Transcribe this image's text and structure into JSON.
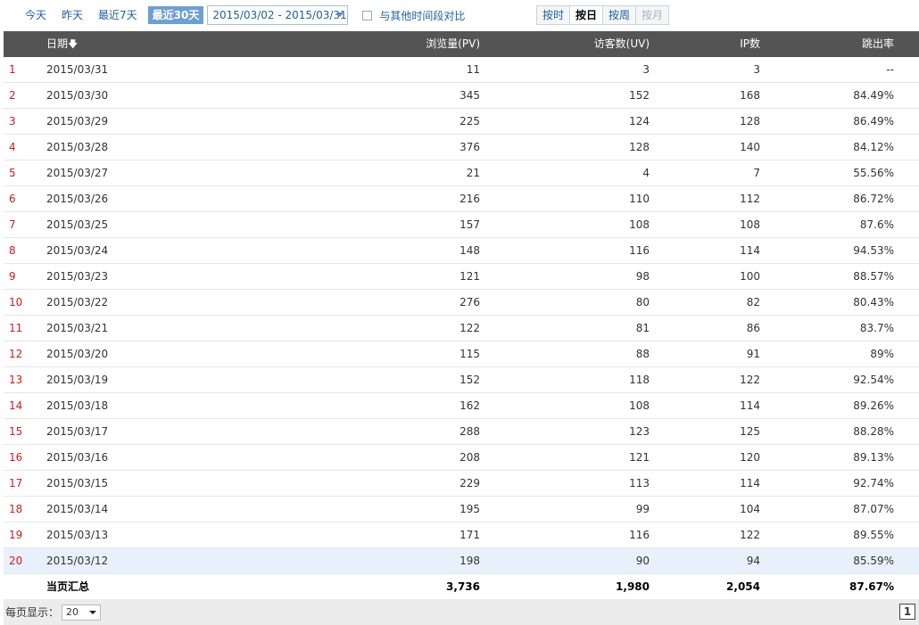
{
  "toolbar": {
    "quick": [
      "今天",
      "昨天",
      "最近7天",
      "最近30天"
    ],
    "active_index": 3,
    "date_range": "2015/03/02 - 2015/03/31",
    "compare_label": "与其他时间段对比",
    "granularity": [
      "按时",
      "按日",
      "按周",
      "按月"
    ],
    "granularity_active": "按日",
    "granularity_disabled": "按月"
  },
  "table": {
    "headers": {
      "date": "日期",
      "date_sort_icon": "arrow-down-icon",
      "pv": "浏览量(PV)",
      "uv": "访客数(UV)",
      "ip": "IP数",
      "bounce": "跳出率"
    },
    "rows": [
      {
        "idx": "1",
        "date": "2015/03/31",
        "pv": "11",
        "uv": "3",
        "ip": "3",
        "bounce": "--"
      },
      {
        "idx": "2",
        "date": "2015/03/30",
        "pv": "345",
        "uv": "152",
        "ip": "168",
        "bounce": "84.49%"
      },
      {
        "idx": "3",
        "date": "2015/03/29",
        "pv": "225",
        "uv": "124",
        "ip": "128",
        "bounce": "86.49%"
      },
      {
        "idx": "4",
        "date": "2015/03/28",
        "pv": "376",
        "uv": "128",
        "ip": "140",
        "bounce": "84.12%"
      },
      {
        "idx": "5",
        "date": "2015/03/27",
        "pv": "21",
        "uv": "4",
        "ip": "7",
        "bounce": "55.56%"
      },
      {
        "idx": "6",
        "date": "2015/03/26",
        "pv": "216",
        "uv": "110",
        "ip": "112",
        "bounce": "86.72%"
      },
      {
        "idx": "7",
        "date": "2015/03/25",
        "pv": "157",
        "uv": "108",
        "ip": "108",
        "bounce": "87.6%"
      },
      {
        "idx": "8",
        "date": "2015/03/24",
        "pv": "148",
        "uv": "116",
        "ip": "114",
        "bounce": "94.53%"
      },
      {
        "idx": "9",
        "date": "2015/03/23",
        "pv": "121",
        "uv": "98",
        "ip": "100",
        "bounce": "88.57%"
      },
      {
        "idx": "10",
        "date": "2015/03/22",
        "pv": "276",
        "uv": "80",
        "ip": "82",
        "bounce": "80.43%"
      },
      {
        "idx": "11",
        "date": "2015/03/21",
        "pv": "122",
        "uv": "81",
        "ip": "86",
        "bounce": "83.7%"
      },
      {
        "idx": "12",
        "date": "2015/03/20",
        "pv": "115",
        "uv": "88",
        "ip": "91",
        "bounce": "89%"
      },
      {
        "idx": "13",
        "date": "2015/03/19",
        "pv": "152",
        "uv": "118",
        "ip": "122",
        "bounce": "92.54%"
      },
      {
        "idx": "14",
        "date": "2015/03/18",
        "pv": "162",
        "uv": "108",
        "ip": "114",
        "bounce": "89.26%"
      },
      {
        "idx": "15",
        "date": "2015/03/17",
        "pv": "288",
        "uv": "123",
        "ip": "125",
        "bounce": "88.28%"
      },
      {
        "idx": "16",
        "date": "2015/03/16",
        "pv": "208",
        "uv": "121",
        "ip": "120",
        "bounce": "89.13%"
      },
      {
        "idx": "17",
        "date": "2015/03/15",
        "pv": "229",
        "uv": "113",
        "ip": "114",
        "bounce": "92.74%"
      },
      {
        "idx": "18",
        "date": "2015/03/14",
        "pv": "195",
        "uv": "99",
        "ip": "104",
        "bounce": "87.07%"
      },
      {
        "idx": "19",
        "date": "2015/03/13",
        "pv": "171",
        "uv": "116",
        "ip": "122",
        "bounce": "89.55%"
      },
      {
        "idx": "20",
        "date": "2015/03/12",
        "pv": "198",
        "uv": "90",
        "ip": "94",
        "bounce": "85.59%"
      }
    ],
    "highlight_row": 19,
    "summary": {
      "label": "当页汇总",
      "pv": "3,736",
      "uv": "1,980",
      "ip": "2,054",
      "bounce": "87.67%"
    }
  },
  "footer": {
    "per_page_label": "每页显示：",
    "per_page_value": "20",
    "current_page": "1"
  },
  "colors": {
    "header_bg": "#545454",
    "index_red": "#d11a1a",
    "link_blue": "#1f5fa6",
    "active_quick_bg": "#6e9fd4",
    "highlight_row_bg": "#e8f1fb"
  }
}
